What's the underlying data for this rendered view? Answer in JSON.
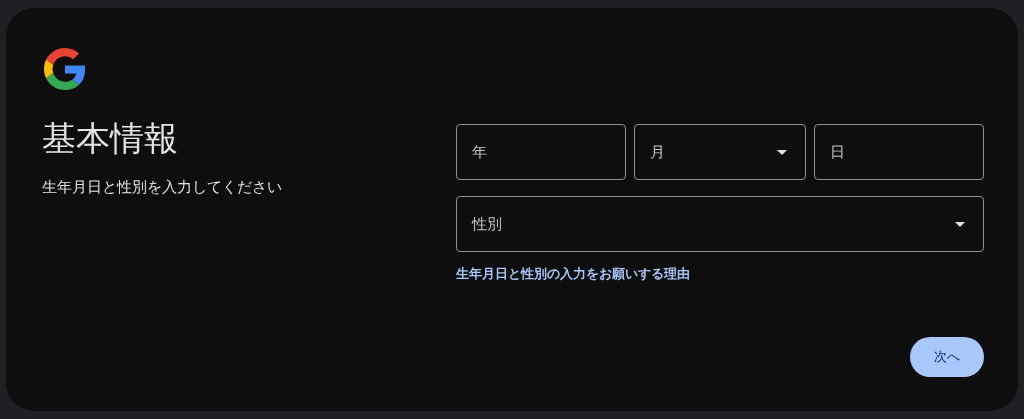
{
  "title": "基本情報",
  "subtitle": "生年月日と性別を入力してください",
  "date_fields": [
    {
      "kind": "text",
      "placeholder": "年"
    },
    {
      "kind": "select",
      "label": "月"
    },
    {
      "kind": "text",
      "placeholder": "日"
    }
  ],
  "gender_field": {
    "kind": "select",
    "label": "性別"
  },
  "help_link": "生年月日と性別の入力をお願いする理由",
  "next_button": "次へ"
}
